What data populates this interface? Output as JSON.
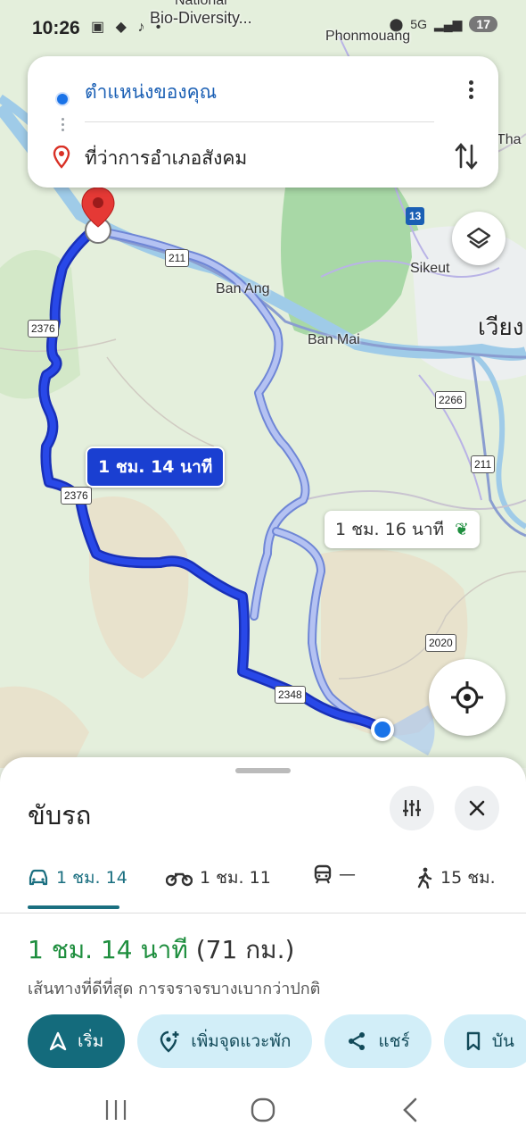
{
  "status_bar": {
    "time": "10:26",
    "battery": "17",
    "signal_label": "5G"
  },
  "search": {
    "origin": "ตำแหน่งของคุณ",
    "destination": "ที่ว่าการอำเภอสังคม"
  },
  "map": {
    "labels": {
      "bio_diversity": "Bio-Diversity...",
      "national": "National",
      "phonmouang": "Phonmouang",
      "thai_partial": "Tha",
      "sikeut": "Sikeut",
      "ban_ang": "Ban Ang",
      "ban_mai": "Ban Mai",
      "vieng_partial": "เวียง",
      "shield_13": "13",
      "shield_211a": "211",
      "shield_211b": "211",
      "shield_2376a": "2376",
      "shield_2376b": "2376",
      "shield_2266": "2266",
      "shield_2020": "2020",
      "shield_2348": "2348"
    },
    "route_main_time": "1 ชม. 14 นาที",
    "route_alt_time": "1 ชม. 16 นาที"
  },
  "sheet": {
    "title": "ขับรถ",
    "tabs": [
      {
        "label": "1 ชม. 14",
        "icon": "car-icon"
      },
      {
        "label": "1 ชม. 11",
        "icon": "motorcycle-icon"
      },
      {
        "label": "—",
        "icon": "transit-icon"
      },
      {
        "label": "15 ชม.",
        "icon": "walk-icon"
      }
    ],
    "duration": "1 ชม. 14 นาที",
    "distance": "(71 กม.)",
    "description": "เส้นทางที่ดีที่สุด การจราจรบางเบากว่าปกติ",
    "actions": {
      "start": "เริ่ม",
      "add_stop": "เพิ่มจุดแวะพัก",
      "share": "แชร์",
      "save": "บัน"
    }
  },
  "colors": {
    "route_main": "#1a3fd1",
    "route_alt": "#a8b8f5",
    "eco": "#1e8e3e",
    "accent": "#146b7c"
  }
}
